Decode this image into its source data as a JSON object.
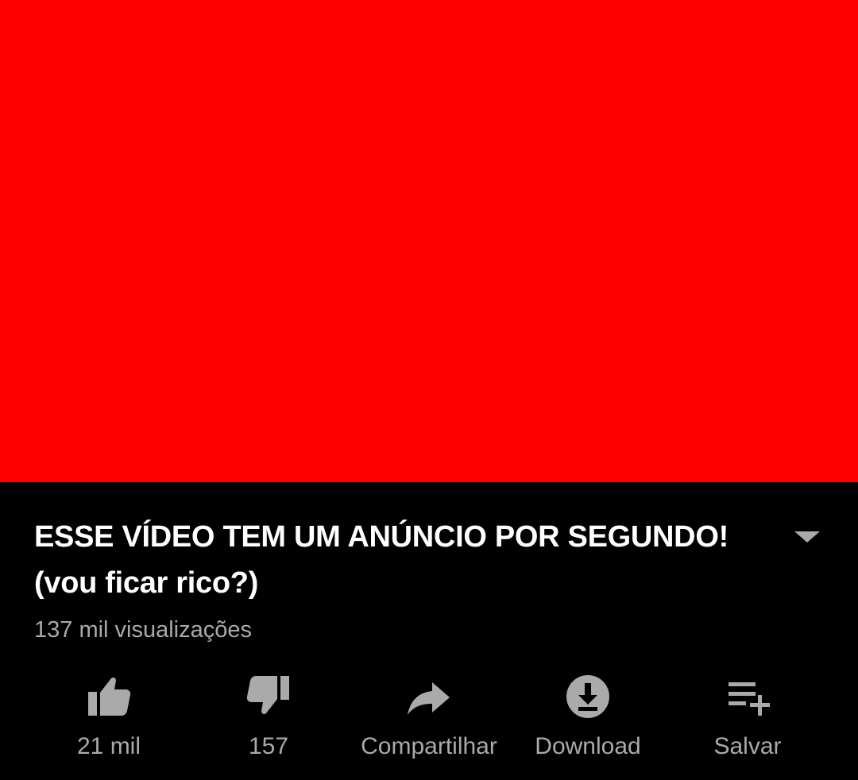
{
  "video": {
    "background_color": "#ff0000"
  },
  "title": {
    "line1": "ESSE VÍDEO TEM UM ANÚNCIO POR SEGUNDO!",
    "line2": "(vou ficar rico?)"
  },
  "expand_icon": "chevron-down-icon",
  "views": "137 mil visualizações",
  "actions": [
    {
      "label": "21 mil",
      "icon": "thumbs-up-icon"
    },
    {
      "label": "157",
      "icon": "thumbs-down-icon"
    },
    {
      "label": "Compartilhar",
      "icon": "share-icon"
    },
    {
      "label": "Download",
      "icon": "download-icon"
    },
    {
      "label": "Salvar",
      "icon": "add-to-playlist-icon"
    }
  ],
  "colors": {
    "background": "#000000",
    "title": "#ffffff",
    "secondary_text": "#aaaaaa",
    "icon": "#aaaaaa"
  }
}
